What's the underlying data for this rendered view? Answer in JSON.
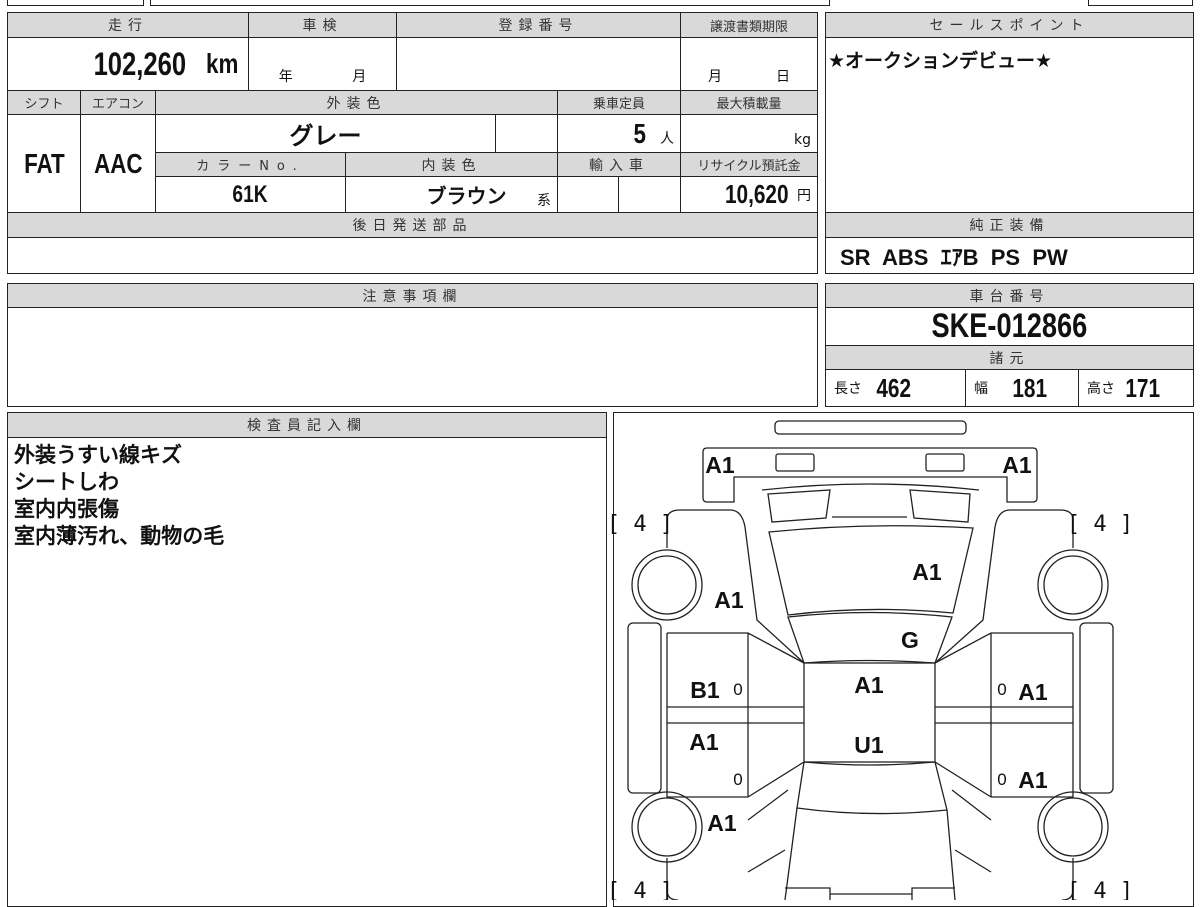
{
  "vehicle_info": {
    "mileage_label": "走行",
    "mileage_value": "102,260",
    "mileage_unit": "km",
    "inspection_label": "車検",
    "inspection_year": "年",
    "inspection_month": "月",
    "registration_label": "登録番号",
    "registration_value": "",
    "doc_deadline_label": "譲渡書類期限",
    "doc_deadline_month": "月",
    "doc_deadline_day": "日",
    "shift_label": "シフト",
    "shift_value": "FAT",
    "aircon_label": "エアコン",
    "aircon_value": "AAC",
    "exterior_color_label": "外装色",
    "exterior_color_value": "グレー",
    "capacity_label": "乗車定員",
    "capacity_value": "5",
    "capacity_unit": "人",
    "max_load_label": "最大積載量",
    "max_load_unit": "kg",
    "color_no_label": "カラーNo.",
    "color_no_value": "61K",
    "interior_color_label": "内装色",
    "interior_color_value": "ブラウン",
    "interior_color_suffix": "系",
    "import_label": "輸入車",
    "recycle_label": "リサイクル預託金",
    "recycle_value": "10,620",
    "recycle_unit": "円",
    "later_parts_label": "後日発送部品"
  },
  "sales_point": {
    "label": "セールスポイント",
    "value": "★オークションデビュー★"
  },
  "equipment": {
    "label": "純正装備",
    "value": "SR  ABS  ｴｱB  PS  PW"
  },
  "notes": {
    "label": "注意事項欄"
  },
  "chassis": {
    "label": "車台番号",
    "value": "SKE-012866",
    "specs_label": "諸元",
    "length_label": "長さ",
    "length_value": "462",
    "width_label": "幅",
    "width_value": "181",
    "height_label": "高さ",
    "height_value": "171"
  },
  "inspector": {
    "label": "検査員記入欄",
    "lines": [
      "外装うすい線キズ",
      "シートしわ",
      "室内内張傷",
      "室内薄汚れ、動物の毛"
    ]
  },
  "diagram": {
    "tire_fl": "[ 4 ]",
    "tire_fr": "[ 4 ]",
    "tire_rl": "[ 4 ]",
    "tire_rr": "[ 4 ]",
    "front_bumper_left": "A1",
    "front_bumper_right": "A1",
    "hood": "A1",
    "front_fender_left": "A1",
    "windshield": "G",
    "front_door_left": "B1",
    "rear_door_left": "A1",
    "roof_front": "A1",
    "roof_rear": "U1",
    "front_door_right": "A1",
    "rear_door_right": "A1",
    "rear_fender_left": "A1",
    "zero_marks": [
      "0",
      "0",
      "0",
      "0"
    ]
  }
}
